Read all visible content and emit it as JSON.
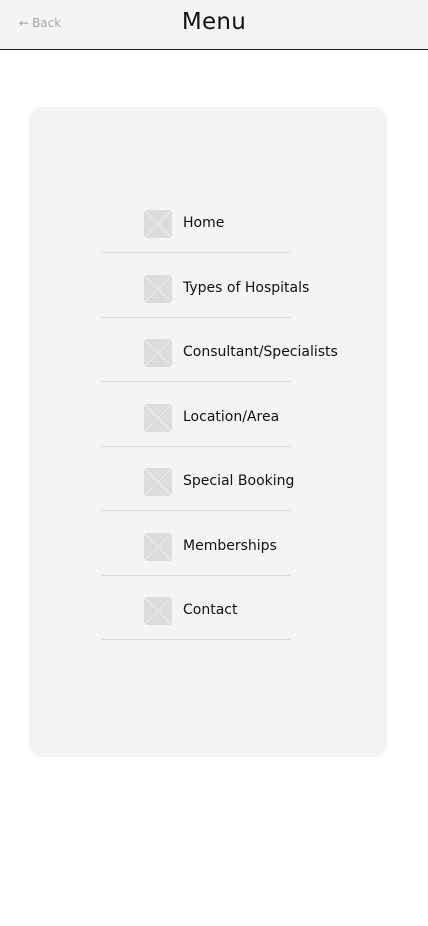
{
  "header": {
    "back_label": "Back",
    "title": "Menu"
  },
  "menu": {
    "items": [
      {
        "label": "Home",
        "icon": "placeholder-image-icon"
      },
      {
        "label": "Types of Hospitals",
        "icon": "placeholder-image-icon"
      },
      {
        "label": "Consultant/Specialists",
        "icon": "placeholder-image-icon"
      },
      {
        "label": "Location/Area",
        "icon": "placeholder-image-icon"
      },
      {
        "label": "Special Booking",
        "icon": "placeholder-image-icon"
      },
      {
        "label": "Memberships",
        "icon": "placeholder-image-icon"
      },
      {
        "label": "Contact",
        "icon": "placeholder-image-icon"
      }
    ]
  },
  "colors": {
    "header_bg": "#f4f4f4",
    "panel_bg": "#f4f4f4",
    "placeholder": "#dcdcdc",
    "text": "#111111",
    "muted": "#a8a8a8"
  }
}
